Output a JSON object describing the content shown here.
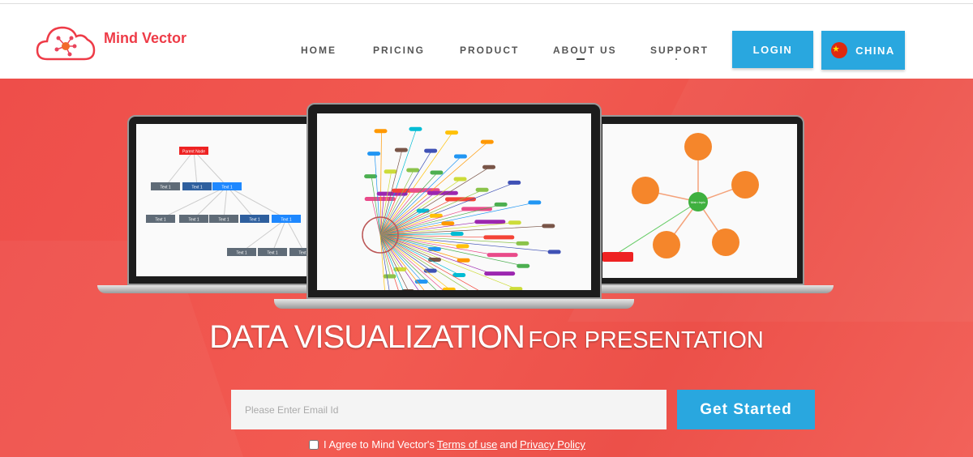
{
  "brand": {
    "name": "Mind Vector",
    "accent": "#ee3b47"
  },
  "nav": {
    "items": [
      {
        "label": "HOME"
      },
      {
        "label": "PRICING"
      },
      {
        "label": "PRODUCT"
      },
      {
        "label": "ABOUT US"
      },
      {
        "label": "SUPPORT"
      }
    ],
    "active": "ABOUT US"
  },
  "header": {
    "login_label": "LOGIN",
    "region_label": "CHINA",
    "region_icon": "china-flag-icon",
    "button_color": "#29a7df"
  },
  "hero": {
    "title_main": "DATA VISUALIZATION",
    "title_sub": "FOR PRESENTATION",
    "background": "#f0544f",
    "tree": {
      "parent": "Parent Node",
      "node": "Text 1"
    },
    "radial": {
      "center": "Main topic"
    }
  },
  "signup": {
    "email_placeholder": "Please Enter Email Id",
    "email_value": "",
    "cta_label": "Get Started",
    "agree_prefix": "I Agree to Mind Vector's",
    "terms_label": "Terms of use",
    "and": "and",
    "privacy_label": "Privacy Policy"
  }
}
